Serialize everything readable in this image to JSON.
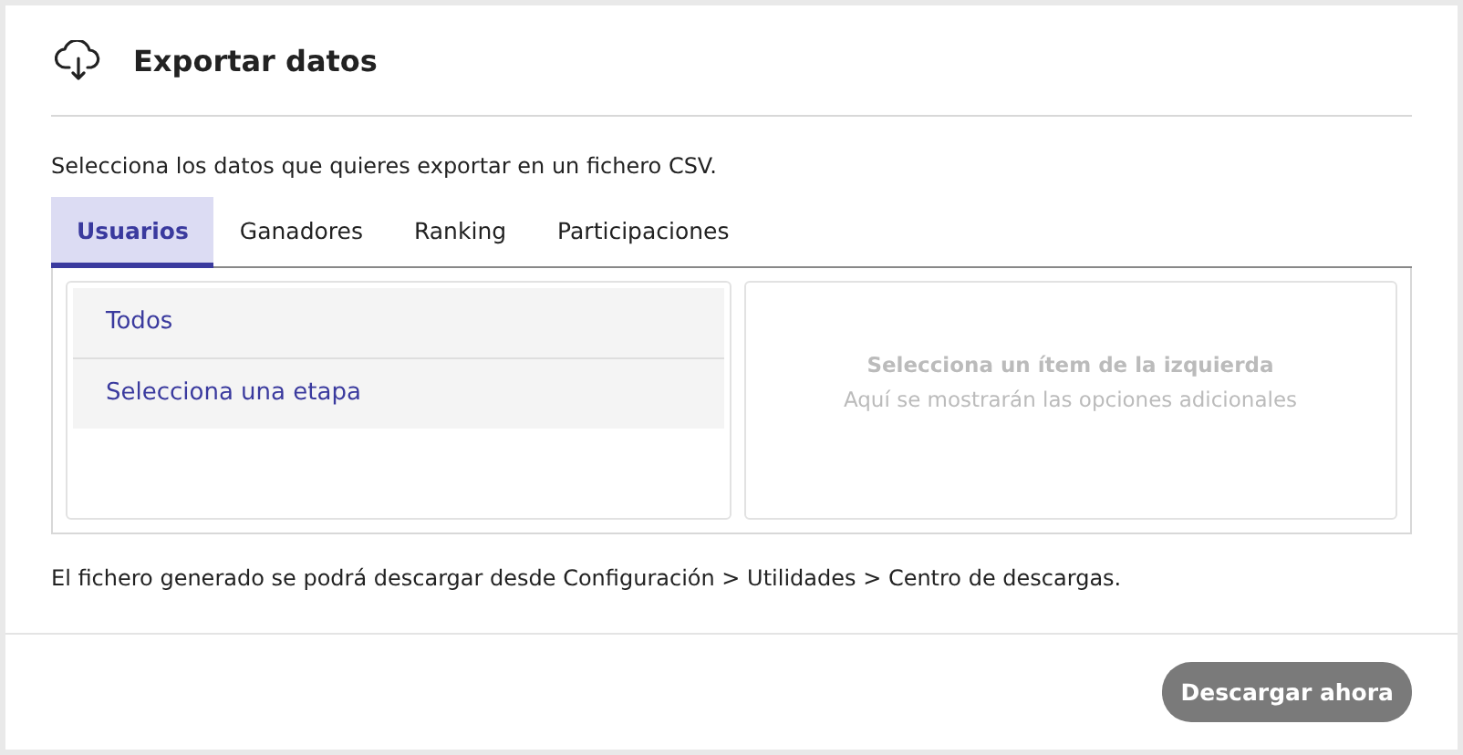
{
  "dialog": {
    "title": "Exportar datos"
  },
  "description": "Selecciona los datos que quieres exportar en un fichero CSV.",
  "tabs": [
    {
      "label": "Usuarios",
      "selected": true
    },
    {
      "label": "Ganadores",
      "selected": false
    },
    {
      "label": "Ranking",
      "selected": false
    },
    {
      "label": "Participaciones",
      "selected": false
    }
  ],
  "options": [
    {
      "label": "Todos"
    },
    {
      "label": "Selecciona una etapa"
    }
  ],
  "detail_panel": {
    "title": "Selecciona un ítem de la izquierda",
    "subtitle": "Aquí se mostrarán las opciones adicionales"
  },
  "note": "El fichero generado se podrá descargar desde Configuración > Utilidades > Centro de descargas.",
  "download_button": {
    "label": "Descargar ahora",
    "disabled": true
  }
}
